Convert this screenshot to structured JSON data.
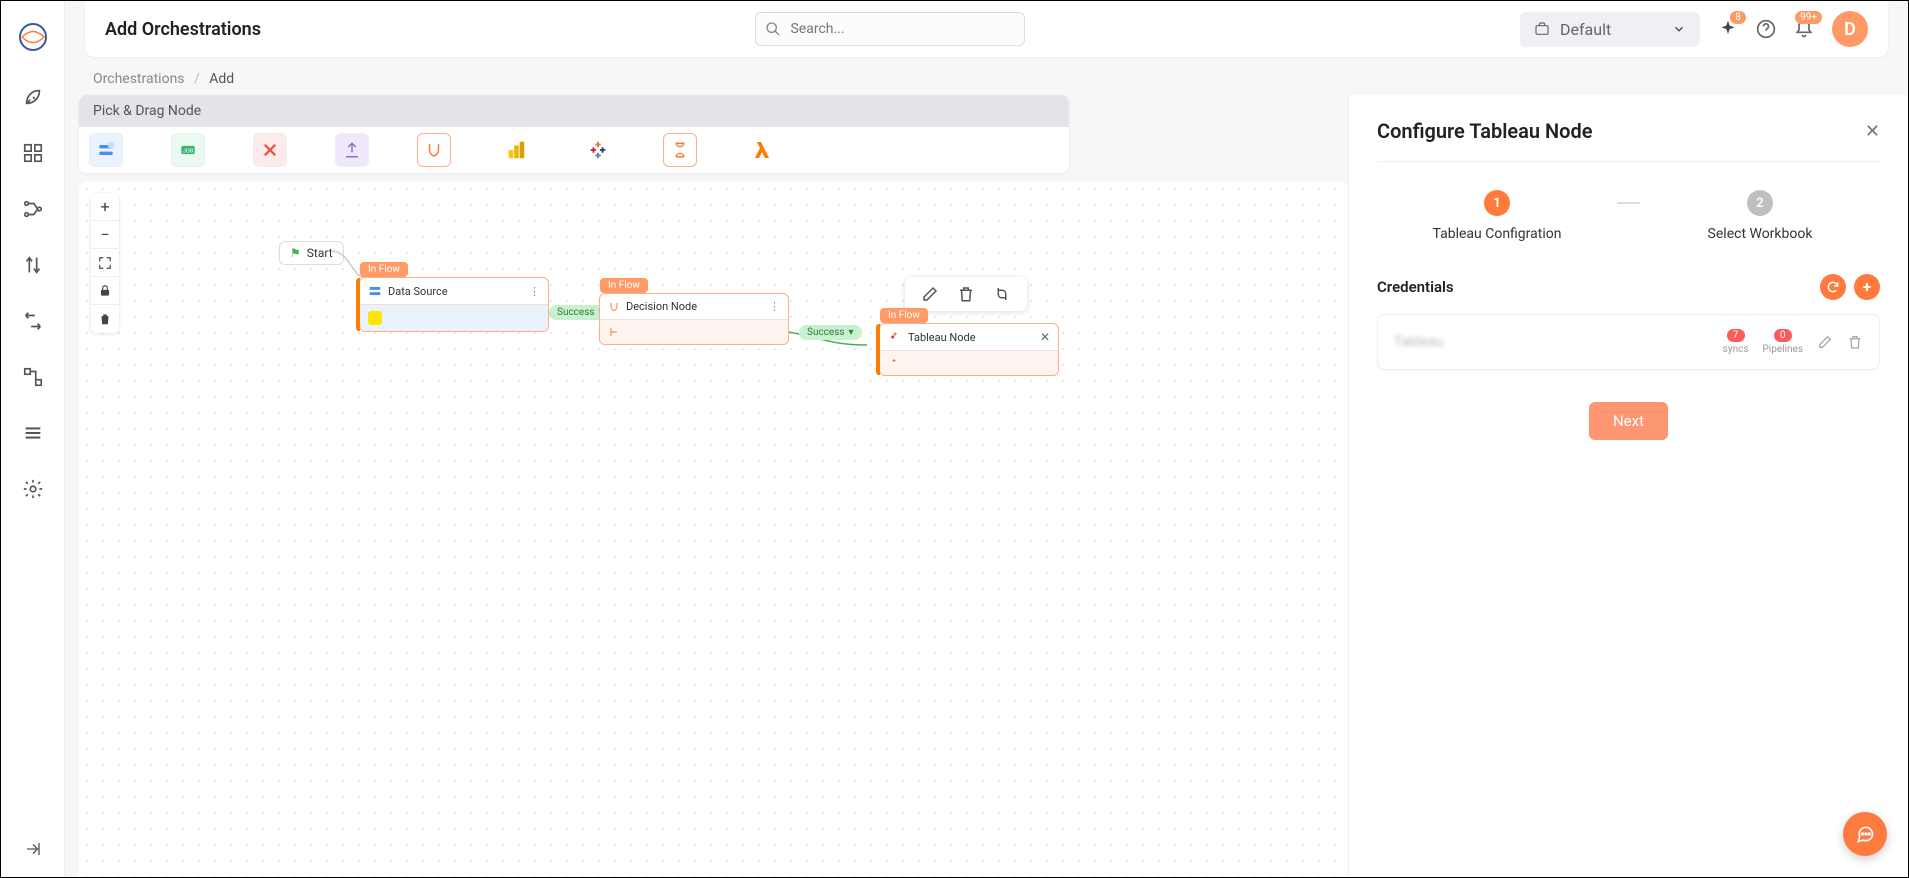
{
  "header": {
    "title": "Add Orchestrations",
    "search_placeholder": "Search...",
    "workspace": "Default",
    "sparkle_badge": "8",
    "bell_badge": "99+",
    "avatar_initial": "D"
  },
  "breadcrumb": {
    "root": "Orchestrations",
    "current": "Add"
  },
  "palette": {
    "title": "Pick & Drag Node"
  },
  "canvas": {
    "start_label": "Start",
    "node1": {
      "tag": "In Flow",
      "title": "Data Source",
      "detail": ""
    },
    "node2": {
      "tag": "In Flow",
      "title": "Decision Node",
      "detail": ""
    },
    "node3": {
      "tag": "In Flow",
      "title": "Tableau Node",
      "detail": ""
    },
    "edge_success": "Success"
  },
  "panel": {
    "title": "Configure Tableau Node",
    "step1_num": "1",
    "step2_num": "2",
    "step1_label": "Tableau Configration",
    "step2_label": "Select Workbook",
    "credentials_title": "Credentials",
    "cred_name": "Tableau",
    "syncs_count": "7",
    "syncs_label": "syncs",
    "pipelines_count": "0",
    "pipelines_label": "Pipelines",
    "next_label": "Next"
  }
}
